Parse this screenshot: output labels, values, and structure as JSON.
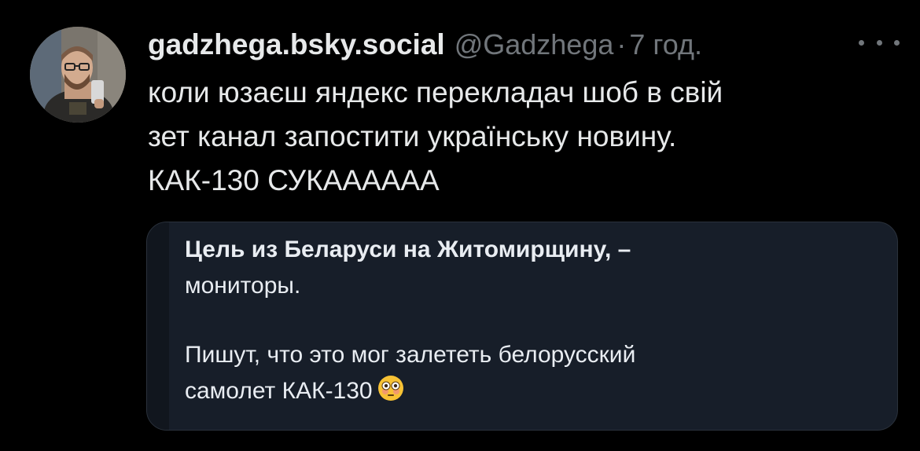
{
  "post": {
    "display_name": "gadzhega.bsky.social",
    "handle": "@Gadzhega",
    "separator": "·",
    "time": "7 год.",
    "more_icon": "more-dots-icon",
    "text_lines": [
      "коли юзаєш яндекс перекладач шоб в свій",
      "зет канал запостити українську новину.",
      "КАК-130 СУКАААААА"
    ]
  },
  "quoted": {
    "headline_line1": "Цель из Беларуси на Житомирщину,  –",
    "headline_line2": "мониторы.",
    "body_line1": "Пишут, что это мог залететь белорусский",
    "body_line2": "самолет КАК-130",
    "emoji": "flushed-face-emoji"
  },
  "colors": {
    "background": "#000000",
    "text_primary": "#e7e9ea",
    "text_secondary": "#71767b",
    "quote_background": "#171e29"
  }
}
